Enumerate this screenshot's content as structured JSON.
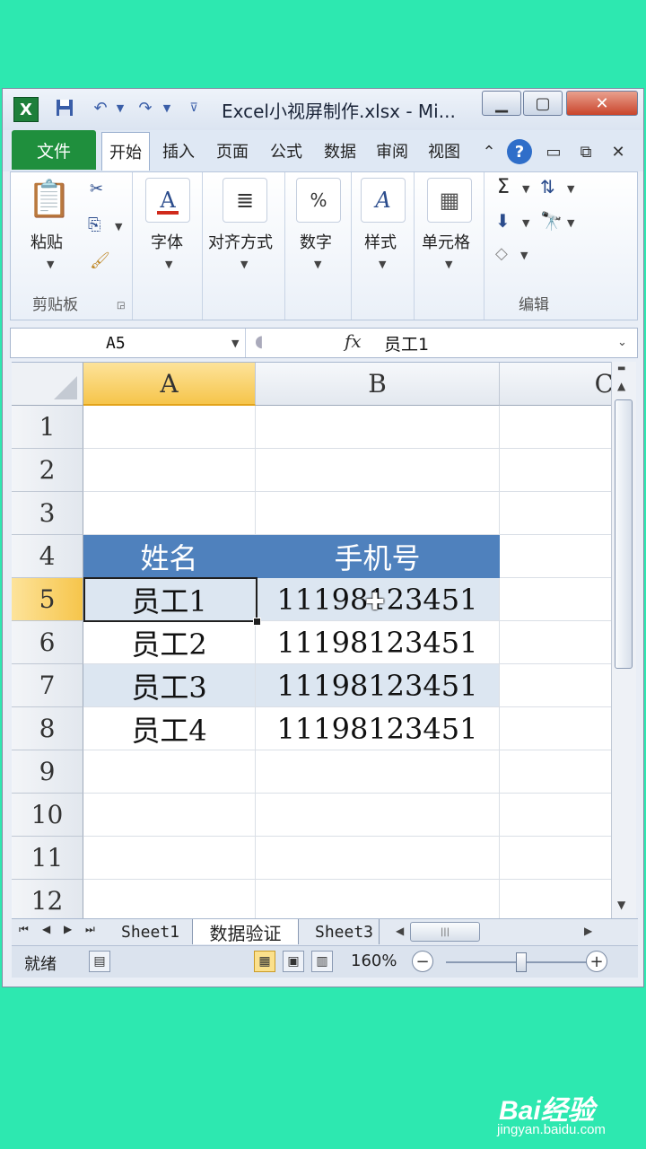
{
  "window": {
    "title": "Excel小视屏制作.xlsx - Mi...",
    "app_icon": "X",
    "min_label": "▁",
    "max_label": "▢",
    "close_label": "✕"
  },
  "tabs": {
    "file": "文件",
    "items": [
      "开始",
      "插入",
      "页面",
      "公式",
      "数据",
      "审阅",
      "视图"
    ],
    "active_index": 0,
    "help": "?"
  },
  "ribbon": {
    "clipboard": {
      "paste": "粘贴",
      "title": "剪贴板"
    },
    "font": {
      "label": "字体"
    },
    "align": {
      "label": "对齐方式"
    },
    "number": {
      "label": "数字"
    },
    "style": {
      "label": "样式"
    },
    "cells": {
      "label": "单元格"
    },
    "edit": {
      "title": "编辑"
    }
  },
  "formula_bar": {
    "name_box": "A5",
    "fx": "fx",
    "value": "员工1"
  },
  "sheet": {
    "columns": [
      "A",
      "B",
      "C"
    ],
    "rows": [
      "1",
      "2",
      "3",
      "4",
      "5",
      "6",
      "7",
      "8",
      "9",
      "10",
      "11",
      "12"
    ],
    "selected_col": "A",
    "selected_row": "5",
    "header": {
      "name": "姓名",
      "phone": "手机号"
    },
    "records": [
      {
        "name": "员工1",
        "phone": "11198123451"
      },
      {
        "name": "员工2",
        "phone": "11198123451"
      },
      {
        "name": "员工3",
        "phone": "11198123451"
      },
      {
        "name": "员工4",
        "phone": "11198123451"
      }
    ],
    "band_color": "#dce6f1",
    "header_color": "#4f81bd"
  },
  "sheet_tabs": [
    "Sheet1",
    "数据验证",
    "Sheet3"
  ],
  "active_sheet_index": 1,
  "status": {
    "ready": "就绪",
    "zoom": "160%",
    "zoom_level_fraction": 0.6
  },
  "watermark": {
    "logo": "Bai经验",
    "url": "jingyan.baidu.com"
  }
}
